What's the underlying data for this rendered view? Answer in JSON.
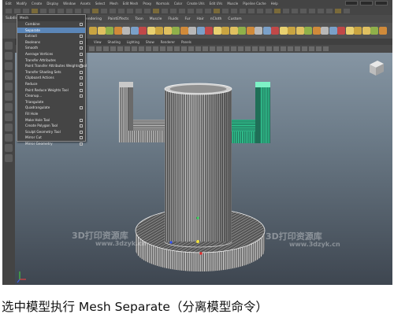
{
  "menubar": {
    "items": [
      "Edit",
      "Modify",
      "Create",
      "Display",
      "Window",
      "Assets",
      "Select",
      "Mesh",
      "Edit Mesh",
      "Proxy",
      "Normals",
      "Color",
      "Create UVs",
      "Edit UVs",
      "Muscle",
      "Pipeline Cache",
      "Help"
    ]
  },
  "shelf": {
    "tabs": [
      "Rendering",
      "PaintEffects",
      "Toon",
      "Muscle",
      "Fluids",
      "Fur",
      "Hair",
      "nCloth",
      "Custom"
    ],
    "first_tab": "Subdivs"
  },
  "viewport": {
    "menu": [
      "View",
      "Shading",
      "Lighting",
      "Show",
      "Renderer",
      "Panels"
    ]
  },
  "menu": {
    "title": "Mesh",
    "items": [
      {
        "label": "Combine",
        "option": true,
        "selected": false
      },
      {
        "label": "Separate",
        "option": false,
        "selected": true
      },
      {
        "label": "Extract",
        "option": true,
        "selected": false
      },
      {
        "label": "Booleans",
        "option": true,
        "selected": false
      },
      {
        "label": "Smooth",
        "option": true,
        "selected": false
      },
      {
        "label": "Average Vertices",
        "option": true,
        "selected": false
      },
      {
        "label": "Transfer Attributes",
        "option": true,
        "selected": false
      },
      {
        "label": "Paint Transfer Attributes Weights Tool",
        "option": true,
        "selected": false
      },
      {
        "label": "Transfer Shading Sets",
        "option": true,
        "selected": false
      },
      {
        "label": "Clipboard Actions",
        "option": true,
        "selected": false
      },
      {
        "label": "Reduce",
        "option": true,
        "selected": false
      },
      {
        "label": "Paint Reduce Weights Tool",
        "option": true,
        "selected": false
      },
      {
        "label": "Cleanup...",
        "option": true,
        "selected": false
      },
      {
        "label": "Triangulate",
        "option": false,
        "selected": false
      },
      {
        "label": "Quadrangulate",
        "option": true,
        "selected": false
      },
      {
        "label": "Fill Hole",
        "option": false,
        "selected": false
      },
      {
        "label": "Make Hole Tool",
        "option": true,
        "selected": false
      },
      {
        "label": "Create Polygon Tool",
        "option": true,
        "selected": false
      },
      {
        "label": "Sculpt Geometry Tool",
        "option": true,
        "selected": false
      },
      {
        "label": "Mirror Cut",
        "option": true,
        "selected": false
      },
      {
        "label": "Mirror Geometry",
        "option": true,
        "selected": false
      }
    ]
  },
  "watermarks": [
    "3D打印资源库",
    "www.3dzyk.cn"
  ],
  "caption": "选中模型执行 Mesh Separate（分离模型命令）",
  "colors": {
    "selection": "#5b86b8",
    "selected_mesh": "#35e8a4",
    "mesh": "#e8e8e8"
  }
}
